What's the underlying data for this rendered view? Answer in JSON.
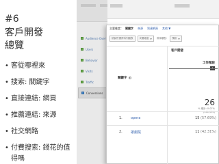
{
  "slide": {
    "number": "#6",
    "title_line1": "客戶開發",
    "title_line2": "總覽",
    "bullets": [
      "客從哪裡來",
      "搜索: 關鍵字",
      "直接連結: 網頁",
      "推薦連結: 來源",
      "社交網路",
      "付費搜索: 錢花的值得嗎"
    ],
    "bullet_symbol": "•"
  },
  "analytics": {
    "primary_dimension_label": "主要維度：",
    "dimensions": [
      "關鍵字",
      "來源",
      "到達網頁",
      "其他"
    ],
    "more_arrow": "▼",
    "controls": {
      "plot_rows": "繪製所選資料列圖表",
      "secondary_dimension": "次要維度",
      "sort_type": "排序類型：",
      "sort_value": "預設"
    },
    "acquisition_header": "客戶開發",
    "keyword_header": "關鍵字",
    "help_glyph": "?",
    "metric_header": "工作階段",
    "sort_arrow": "↓",
    "total": {
      "value": "26",
      "percent_line": "% 總計: 0.07%",
      "total_line": "(160,532)"
    },
    "rows": [
      {
        "rank": "1.",
        "keyword": "opera",
        "value": "15",
        "percent": "(57.69%)"
      },
      {
        "rank": "2.",
        "keyword": "歌劇院",
        "value": "11",
        "percent": "(42.31%)"
      }
    ],
    "nav_items": [
      "Audience Overview",
      "Users",
      "Behavior",
      "Visits",
      "Traffic",
      "Conversions"
    ]
  }
}
